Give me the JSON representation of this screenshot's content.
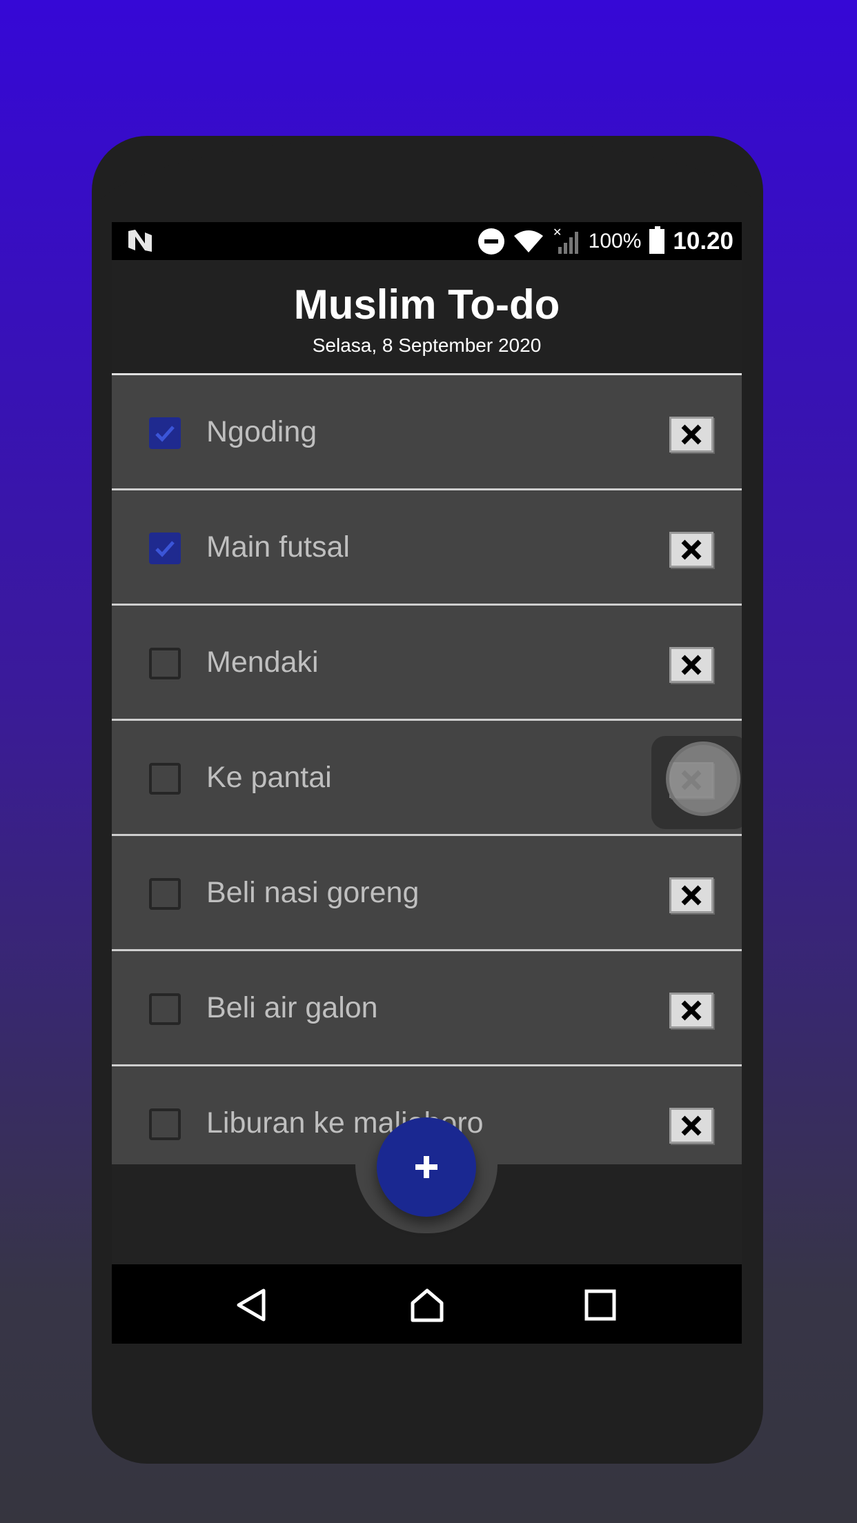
{
  "status_bar": {
    "battery": "100%",
    "time": "10.20",
    "icons": [
      "notification-n-icon",
      "do-not-disturb-icon",
      "wifi-icon",
      "signal-icon",
      "battery-charging-icon"
    ]
  },
  "app": {
    "title": "Muslim To-do",
    "date": "Selasa, 8 September 2020"
  },
  "todos": [
    {
      "label": "Ngoding",
      "checked": true
    },
    {
      "label": "Main futsal",
      "checked": true
    },
    {
      "label": "Mendaki",
      "checked": false
    },
    {
      "label": "Ke pantai",
      "checked": false
    },
    {
      "label": "Beli nasi goreng",
      "checked": false
    },
    {
      "label": "Beli air galon",
      "checked": false
    },
    {
      "label": "Liburan ke malioboro",
      "checked": false
    }
  ],
  "fab": {
    "icon": "plus-icon"
  },
  "nav": [
    "back-icon",
    "home-icon",
    "recents-icon"
  ],
  "colors": {
    "accent": "#1a2891",
    "row_bg": "#444444",
    "header_bg": "#212121",
    "bg_top": "#3608d6",
    "bg_bottom": "#36353f"
  }
}
